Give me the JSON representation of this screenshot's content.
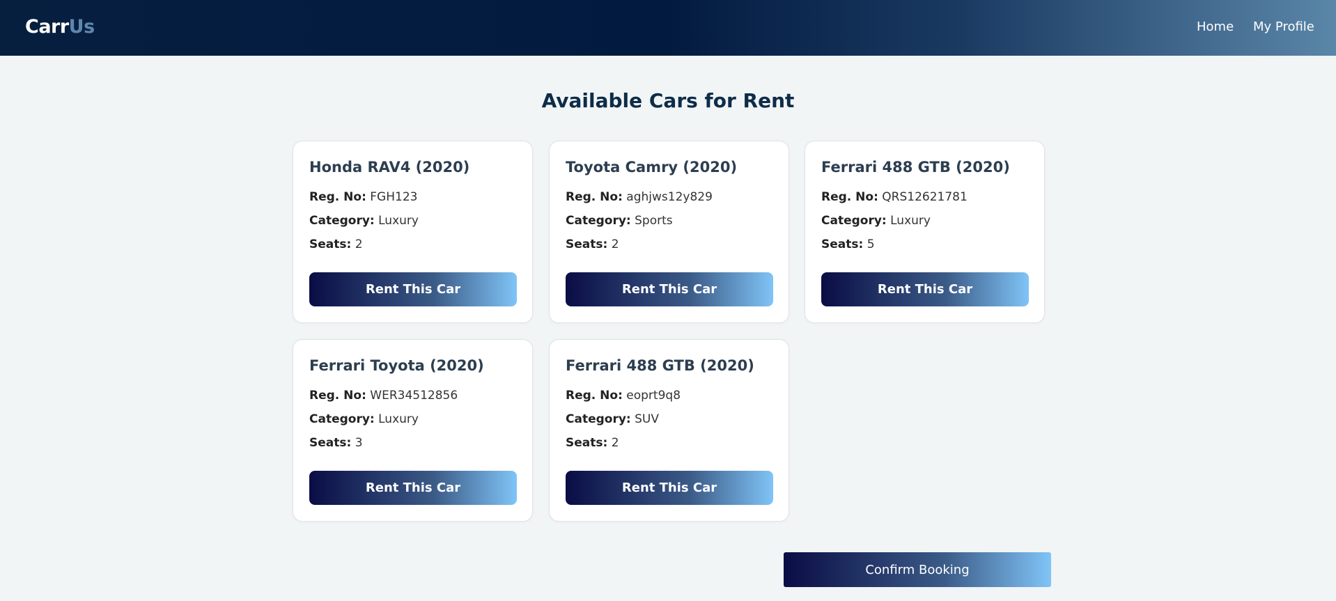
{
  "app": {
    "brand_part1": "Carr",
    "brand_part2": "Us"
  },
  "nav": {
    "home": "Home",
    "profile": "My Profile"
  },
  "page": {
    "title": "Available Cars for Rent"
  },
  "labels": {
    "reg": "Reg. No:",
    "category": "Category:",
    "seats": "Seats:",
    "rent_button": "Rent This Car"
  },
  "cars": [
    {
      "title": "Honda RAV4 (2020)",
      "reg_no": "FGH123",
      "category": "Luxury",
      "seats": "2"
    },
    {
      "title": "Toyota Camry (2020)",
      "reg_no": "aghjws12y829",
      "category": "Sports",
      "seats": "2"
    },
    {
      "title": "Ferrari 488 GTB (2020)",
      "reg_no": "QRS12621781",
      "category": "Luxury",
      "seats": "5"
    },
    {
      "title": "Ferrari Toyota (2020)",
      "reg_no": "WER34512856",
      "category": "Luxury",
      "seats": "3"
    },
    {
      "title": "Ferrari 488 GTB (2020)",
      "reg_no": "eoprt9q8",
      "category": "SUV",
      "seats": "2"
    }
  ],
  "footer": {
    "confirm_button": "Confirm Booking"
  },
  "colors": {
    "nav_dark": "#031a40",
    "nav_light": "#5a86a8",
    "button_start": "#0a0d45",
    "button_end": "#80c4f7",
    "page_bg": "#f1f5f6"
  }
}
